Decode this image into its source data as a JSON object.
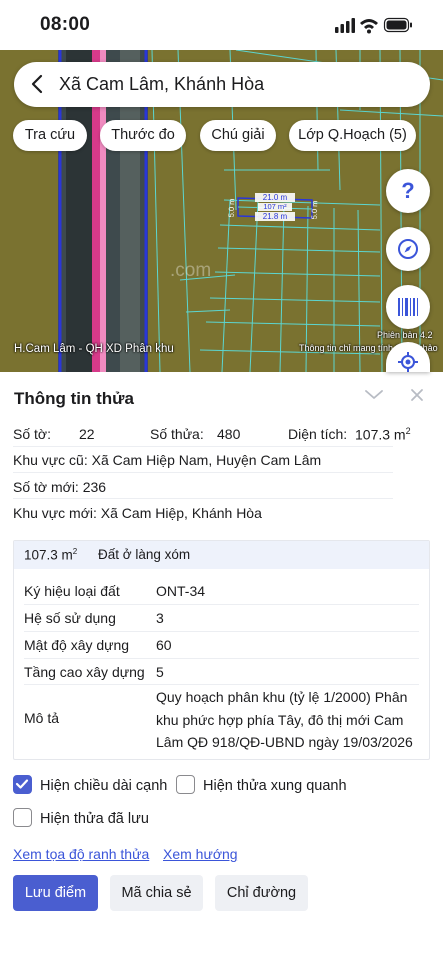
{
  "status_bar": {
    "time": "08:00"
  },
  "search": {
    "title": "Xã Cam Lâm, Khánh Hòa"
  },
  "chips": [
    "Tra cứu",
    "Thước đo",
    "Chú giải",
    "Lớp Q.Hoạch (5)"
  ],
  "map": {
    "bottom_left_label": "H.Cam Lâm - QH XD Phân khu",
    "bottom_right_label": "Thông tin chỉ mang tính tham khảo",
    "version_label": "Phiên bản 4.2",
    "watermark": ".com",
    "parcel": {
      "top_edge": "21.0 m",
      "area": "107 m²",
      "bottom_edge": "21.8 m",
      "left_edge": "5.0 m",
      "right_edge": "5.0 m"
    }
  },
  "panel": {
    "title": "Thông tin thửa",
    "so_to_label": "Số tờ:",
    "so_to_value": "22",
    "so_thua_label": "Số thửa:",
    "so_thua_value": "480",
    "dien_tich_label": "Diện tích:",
    "dien_tich_value": "107.3 m",
    "dien_tich_unit_sup": "2",
    "khu_vuc_cu": "Khu vực cũ: Xã Cam Hiệp Nam, Huyện Cam Lâm",
    "so_to_moi": "Số tờ mới: 236",
    "khu_vuc_moi": "Khu vực mới: Xã Cam Hiệp, Khánh Hòa"
  },
  "card": {
    "area": "107.3 m",
    "area_sup": "2",
    "land_type": "Đất ở làng xóm",
    "rows": [
      {
        "label": "Ký hiệu loại đất",
        "value": "ONT-34"
      },
      {
        "label": "Hệ số sử dụng",
        "value": "3"
      },
      {
        "label": "Mật độ xây dựng",
        "value": "60"
      },
      {
        "label": "Tầng cao xây dựng",
        "value": "5"
      }
    ],
    "desc_label": "Mô tả",
    "desc_lines": [
      "Quy hoạch phân khu (tỷ lệ 1/2000) Phân",
      "khu phức hợp phía Tây, đô thị mới Cam",
      "Lâm QĐ 918/QĐ-UBND ngày 19/03/2026"
    ]
  },
  "options": {
    "show_edge_length": {
      "label": "Hiện chiều dài cạnh",
      "checked": true
    },
    "show_surrounding": {
      "label": "Hiện thửa xung quanh",
      "checked": false
    },
    "show_saved": {
      "label": "Hiện thửa đã lưu",
      "checked": false
    }
  },
  "links": {
    "coords": "Xem tọa độ ranh thửa",
    "direction": "Xem hướng"
  },
  "buttons": {
    "save": "Lưu điểm",
    "share": "Mã chia sẻ",
    "route": "Chỉ đường"
  },
  "colors": {
    "accent": "#4a5ed0",
    "link": "#3b55d9",
    "map_base": "#7a7230",
    "parcel_lines": "#5cd6d0"
  }
}
